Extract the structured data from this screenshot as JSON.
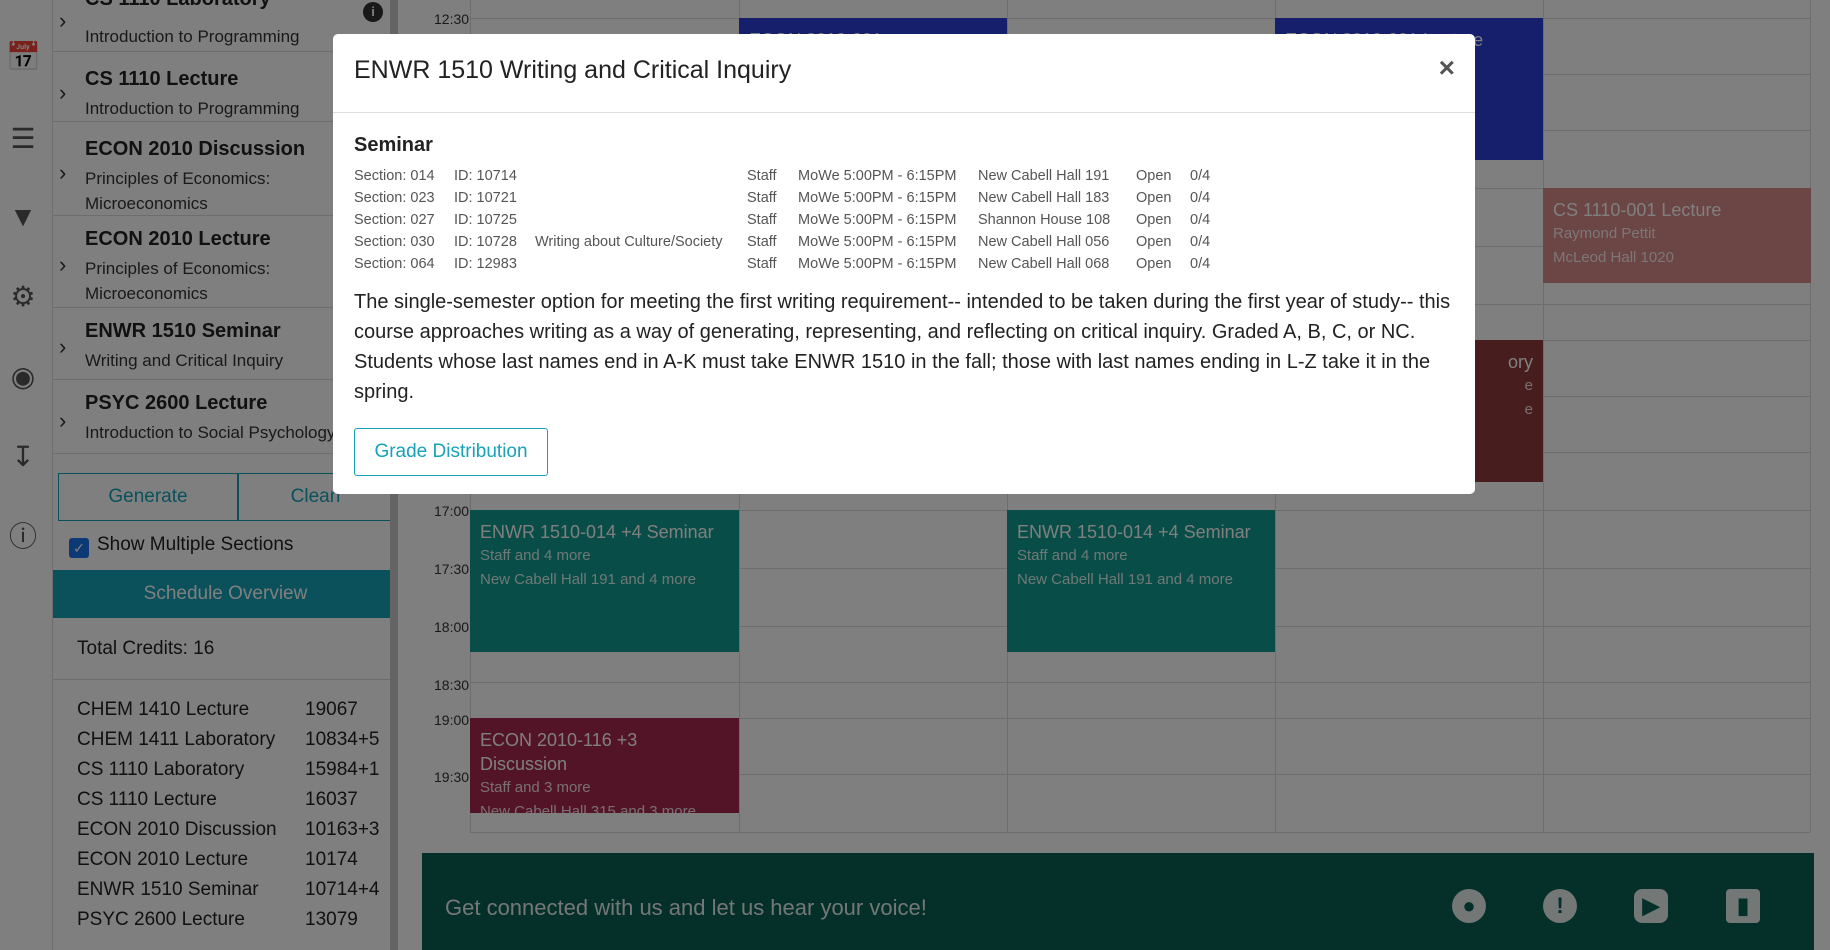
{
  "sidebar": {
    "courses": [
      {
        "title": "CS 1110 Laboratory",
        "subtitle": "Introduction to Programming"
      },
      {
        "title": "CS 1110 Lecture",
        "subtitle": "Introduction to Programming"
      },
      {
        "title": "ECON 2010 Discussion",
        "subtitle": "Principles of Economics: Microeconomics"
      },
      {
        "title": "ECON 2010 Lecture",
        "subtitle": "Principles of Economics: Microeconomics"
      },
      {
        "title": "ENWR 1510 Seminar",
        "subtitle": "Writing and Critical Inquiry"
      },
      {
        "title": "PSYC 2600 Lecture",
        "subtitle": "Introduction to Social Psychology"
      }
    ],
    "generate_label": "Generate",
    "clear_label": "Clean",
    "show_multiple_label": "Show Multiple Sections",
    "overview_label": "Schedule Overview",
    "total_credits": "Total Credits: 16",
    "summary": [
      {
        "name": "CHEM 1410 Lecture",
        "value": "19067"
      },
      {
        "name": "CHEM 1411 Laboratory",
        "value": "10834+5"
      },
      {
        "name": "CS 1110 Laboratory",
        "value": "15984+1"
      },
      {
        "name": "CS 1110 Lecture",
        "value": "16037"
      },
      {
        "name": "ECON 2010 Discussion",
        "value": "10163+3"
      },
      {
        "name": "ECON 2010 Lecture",
        "value": "10174"
      },
      {
        "name": "ENWR 1510 Seminar",
        "value": "10714+4"
      },
      {
        "name": "PSYC 2600 Lecture",
        "value": "13079"
      }
    ]
  },
  "calendar": {
    "times": [
      "12:30",
      "17:00",
      "17:30",
      "18:00",
      "18:30",
      "19:00",
      "19:30"
    ],
    "events": [
      {
        "title": "ECON 2010-001",
        "sub1": "",
        "sub2": "",
        "color": "#2a3fd6"
      },
      {
        "title": "ECON 2010-001 Lecture",
        "sub1": "",
        "sub2": "",
        "color": "#2a3fd6"
      },
      {
        "title": "CS 1110-001 Lecture",
        "sub1": "Raymond Pettit",
        "sub2": "McLeod Hall 1020",
        "color": "#d98a8a"
      },
      {
        "title": "ory",
        "sub1": "e",
        "sub2": "e",
        "color": "#8e3b3b"
      },
      {
        "title": "ENWR 1510-014 +4 Seminar",
        "sub1": "Staff and 4 more",
        "sub2": "New Cabell Hall 191 and 4 more",
        "color": "#119b8e"
      },
      {
        "title": "ENWR 1510-014 +4 Seminar",
        "sub1": "Staff and 4 more",
        "sub2": "New Cabell Hall 191 and 4 more",
        "color": "#119b8e"
      },
      {
        "title": "ECON 2010-116 +3 Discussion",
        "sub1": "Staff and 3 more",
        "sub2": "New Cabell Hall 315 and 3 more",
        "color": "#a8294f"
      }
    ]
  },
  "footer": {
    "text": "Get connected with us and let us hear your voice!",
    "icons": [
      "github-icon",
      "alert-icon",
      "youtube-icon",
      "chart-icon"
    ]
  },
  "modal": {
    "title": "ENWR 1510 Writing and Critical Inquiry",
    "close": "×",
    "section_type": "Seminar",
    "sections": [
      {
        "section": "Section: 014",
        "id": "ID: 10714",
        "topic": "",
        "instructor": "Staff",
        "time": "MoWe 5:00PM - 6:15PM",
        "room": "New Cabell Hall 191",
        "status": "Open",
        "enrollment": "0/4"
      },
      {
        "section": "Section: 023",
        "id": "ID: 10721",
        "topic": "",
        "instructor": "Staff",
        "time": "MoWe 5:00PM - 6:15PM",
        "room": "New Cabell Hall 183",
        "status": "Open",
        "enrollment": "0/4"
      },
      {
        "section": "Section: 027",
        "id": "ID: 10725",
        "topic": "",
        "instructor": "Staff",
        "time": "MoWe 5:00PM - 6:15PM",
        "room": "Shannon House 108",
        "status": "Open",
        "enrollment": "0/4"
      },
      {
        "section": "Section: 030",
        "id": "ID: 10728",
        "topic": "Writing about Culture/Society",
        "instructor": "Staff",
        "time": "MoWe 5:00PM - 6:15PM",
        "room": "New Cabell Hall 056",
        "status": "Open",
        "enrollment": "0/4"
      },
      {
        "section": "Section: 064",
        "id": "ID: 12983",
        "topic": "",
        "instructor": "Staff",
        "time": "MoWe 5:00PM - 6:15PM",
        "room": "New Cabell Hall 068",
        "status": "Open",
        "enrollment": "0/4"
      }
    ],
    "description": "The single-semester option for meeting the first writing requirement-- intended to be taken during the first year of study-- this course approaches writing as a way of generating, representing, and reflecting on critical inquiry. Graded A, B, C, or NC. Students whose last names end in A-K must take ENWR 1510 in the fall; those with last names ending in L-Z take it in the spring.",
    "grade_button": "Grade Distribution"
  }
}
